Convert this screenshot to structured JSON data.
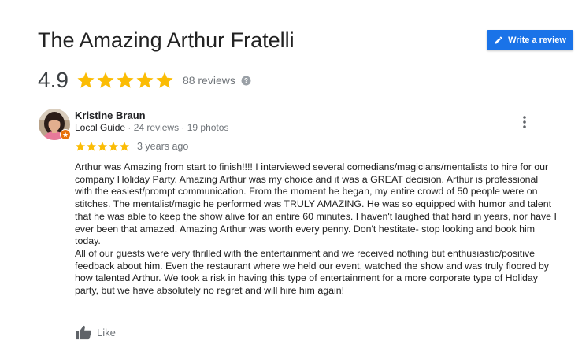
{
  "header": {
    "title": "The Amazing Arthur Fratelli",
    "write_review_label": "Write a review",
    "write_review_icon": "pencil-icon",
    "accent_color": "#1a73e8"
  },
  "summary": {
    "rating": "4.9",
    "stars": 5,
    "review_count": "88 reviews",
    "star_color": "#fbbc04",
    "help_icon": "question-icon"
  },
  "review": {
    "author": "Kristine Braun",
    "guide_label": "Local Guide",
    "meta_suffix": " · 24 reviews · 19 photos",
    "badge_icon": "local-guide-star-icon",
    "stars": 5,
    "date": "3 years ago",
    "paragraphs": [
      "Arthur was Amazing from start to finish!!!!  I interviewed several comedians/magicians/mentalists to hire for our company Holiday Party. Amazing Arthur was my choice and it was a GREAT decision. Arthur is professional with the easiest/prompt communication.  From the moment he began, my entire crowd of 50 people were on stitches. The mentalist/magic he performed was TRULY AMAZING. He was so equipped with humor and talent that he was able to keep the show alive for an entire 60 minutes. I haven't laughed that hard in years, nor have I ever been that amazed. Amazing Arthur was worth every penny. Don't hestitate- stop looking and book him today.",
      "All of our guests were very thrilled with the entertainment and we received nothing but enthusiastic/positive feedback about him. Even the restaurant where we held our event, watched the show and was truly floored by how talented Arthur. We took a risk in having this type of entertainment for a more corporate type of Holiday party, but we have absolutely no regret and will hire him again!"
    ],
    "like_label": "Like",
    "like_icon": "thumbs-up-icon",
    "more_icon": "more-vertical-icon"
  }
}
